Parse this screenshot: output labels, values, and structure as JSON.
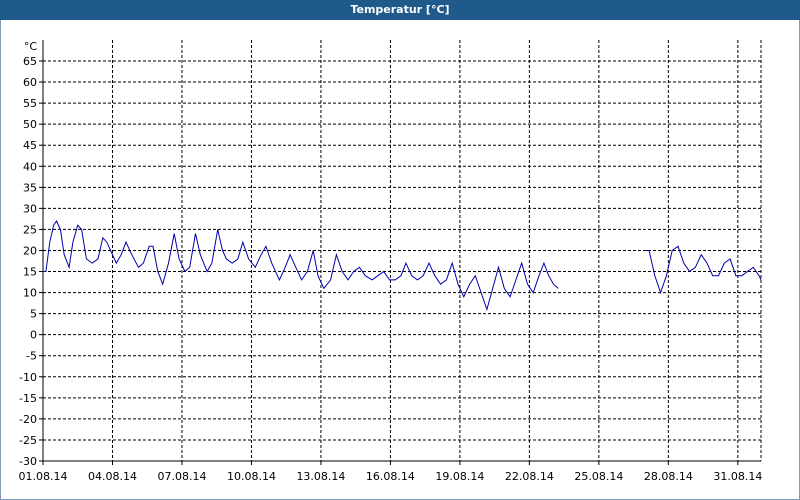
{
  "window": {
    "title": "Temperatur [°C]"
  },
  "chart_data": {
    "type": "line",
    "title": "Temperatur [°C]",
    "ylabel": "°C",
    "xlabel": "",
    "ylim": [
      -30,
      70
    ],
    "yticks": [
      65,
      60,
      55,
      50,
      45,
      40,
      35,
      30,
      25,
      20,
      15,
      10,
      5,
      0,
      -5,
      -10,
      -15,
      -20,
      -25,
      -30
    ],
    "xlim": [
      "2014-08-01",
      "2014-09-01"
    ],
    "xticks": [
      "01.08.14",
      "04.08.14",
      "07.08.14",
      "10.08.14",
      "13.08.14",
      "16.08.14",
      "19.08.14",
      "22.08.14",
      "25.08.14",
      "28.08.14",
      "31.08.14"
    ],
    "grid": true,
    "colors": {
      "line": "#0000aa",
      "grid": "#000000",
      "titlebar": "#1f5a8b"
    },
    "series": [
      {
        "segments": [
          [
            [
              "2014-08-01T00:00",
              15
            ],
            [
              "2014-08-01T03:00",
              15
            ],
            [
              "2014-08-01T07:00",
              22
            ],
            [
              "2014-08-01T11:00",
              26
            ],
            [
              "2014-08-01T14:00",
              27
            ],
            [
              "2014-08-01T18:00",
              25
            ],
            [
              "2014-08-01T22:00",
              19
            ],
            [
              "2014-08-02T03:00",
              16
            ],
            [
              "2014-08-02T07:00",
              22
            ],
            [
              "2014-08-02T12:00",
              26
            ],
            [
              "2014-08-02T16:00",
              25
            ],
            [
              "2014-08-02T21:00",
              18
            ],
            [
              "2014-08-03T03:00",
              17
            ],
            [
              "2014-08-03T09:00",
              18
            ],
            [
              "2014-08-03T14:00",
              23
            ],
            [
              "2014-08-03T18:00",
              22
            ],
            [
              "2014-08-03T22:00",
              20
            ],
            [
              "2014-08-04T04:00",
              17
            ],
            [
              "2014-08-04T09:00",
              19
            ],
            [
              "2014-08-04T14:00",
              22
            ],
            [
              "2014-08-04T20:00",
              19
            ],
            [
              "2014-08-05T03:00",
              16
            ],
            [
              "2014-08-05T08:00",
              17
            ],
            [
              "2014-08-05T14:00",
              21
            ],
            [
              "2014-08-05T18:00",
              21
            ],
            [
              "2014-08-05T23:00",
              15
            ],
            [
              "2014-08-06T04:00",
              12
            ],
            [
              "2014-08-06T10:00",
              17
            ],
            [
              "2014-08-06T16:00",
              24
            ],
            [
              "2014-08-06T21:00",
              18
            ],
            [
              "2014-08-07T03:00",
              15
            ],
            [
              "2014-08-07T08:00",
              16
            ],
            [
              "2014-08-07T14:00",
              24
            ],
            [
              "2014-08-07T19:00",
              19
            ],
            [
              "2014-08-08T02:00",
              15
            ],
            [
              "2014-08-08T07:00",
              17
            ],
            [
              "2014-08-08T13:00",
              25
            ],
            [
              "2014-08-08T18:00",
              20
            ],
            [
              "2014-08-08T22:00",
              18
            ],
            [
              "2014-08-09T04:00",
              17
            ],
            [
              "2014-08-09T10:00",
              18
            ],
            [
              "2014-08-09T15:00",
              22
            ],
            [
              "2014-08-09T21:00",
              18
            ],
            [
              "2014-08-10T04:00",
              16
            ],
            [
              "2014-08-10T10:00",
              19
            ],
            [
              "2014-08-10T15:00",
              21
            ],
            [
              "2014-08-10T21:00",
              17
            ],
            [
              "2014-08-11T05:00",
              13
            ],
            [
              "2014-08-11T11:00",
              16
            ],
            [
              "2014-08-11T16:00",
              19
            ],
            [
              "2014-08-11T22:00",
              16
            ],
            [
              "2014-08-12T04:00",
              13
            ],
            [
              "2014-08-12T10:00",
              15
            ],
            [
              "2014-08-12T16:00",
              20
            ],
            [
              "2014-08-12T21:00",
              14
            ],
            [
              "2014-08-13T03:00",
              11
            ],
            [
              "2014-08-13T10:00",
              13
            ],
            [
              "2014-08-13T16:00",
              19
            ],
            [
              "2014-08-13T22:00",
              15
            ],
            [
              "2014-08-14T04:00",
              13
            ],
            [
              "2014-08-14T10:00",
              15
            ],
            [
              "2014-08-14T16:00",
              16
            ],
            [
              "2014-08-14T22:00",
              14
            ],
            [
              "2014-08-15T05:00",
              13
            ],
            [
              "2014-08-15T11:00",
              14
            ],
            [
              "2014-08-15T17:00",
              15
            ],
            [
              "2014-08-15T23:00",
              13
            ],
            [
              "2014-08-16T05:00",
              13
            ],
            [
              "2014-08-16T11:00",
              14
            ],
            [
              "2014-08-16T16:00",
              17
            ],
            [
              "2014-08-16T22:00",
              14
            ],
            [
              "2014-08-17T04:00",
              13
            ],
            [
              "2014-08-17T10:00",
              14
            ],
            [
              "2014-08-17T16:00",
              17
            ],
            [
              "2014-08-17T22:00",
              14
            ],
            [
              "2014-08-18T04:00",
              12
            ],
            [
              "2014-08-18T10:00",
              13
            ],
            [
              "2014-08-18T16:00",
              17
            ],
            [
              "2014-08-18T22:00",
              12
            ],
            [
              "2014-08-19T04:00",
              9
            ],
            [
              "2014-08-19T10:00",
              12
            ],
            [
              "2014-08-19T16:00",
              14
            ],
            [
              "2014-08-19T22:00",
              10
            ],
            [
              "2014-08-20T04:00",
              6
            ],
            [
              "2014-08-20T10:00",
              11
            ],
            [
              "2014-08-20T16:00",
              16
            ],
            [
              "2014-08-20T22:00",
              11
            ],
            [
              "2014-08-21T04:00",
              9
            ],
            [
              "2014-08-21T10:00",
              13
            ],
            [
              "2014-08-21T16:00",
              17
            ],
            [
              "2014-08-21T22:00",
              12
            ],
            [
              "2014-08-22T04:00",
              10
            ],
            [
              "2014-08-22T10:00",
              14
            ],
            [
              "2014-08-22T15:00",
              17
            ],
            [
              "2014-08-22T20:00",
              14
            ],
            [
              "2014-08-23T01:00",
              12
            ],
            [
              "2014-08-23T06:00",
              11
            ]
          ],
          [
            [
              "2014-08-27T00:00",
              20
            ],
            [
              "2014-08-27T04:00",
              20
            ],
            [
              "2014-08-27T10:00",
              14
            ],
            [
              "2014-08-27T16:00",
              10
            ],
            [
              "2014-08-27T22:00",
              14
            ],
            [
              "2014-08-28T04:00",
              20
            ],
            [
              "2014-08-28T10:00",
              21
            ],
            [
              "2014-08-28T16:00",
              17
            ],
            [
              "2014-08-28T22:00",
              15
            ],
            [
              "2014-08-29T04:00",
              16
            ],
            [
              "2014-08-29T10:00",
              19
            ],
            [
              "2014-08-29T16:00",
              17
            ],
            [
              "2014-08-29T22:00",
              14
            ],
            [
              "2014-08-30T04:00",
              14
            ],
            [
              "2014-08-30T10:00",
              17
            ],
            [
              "2014-08-30T16:00",
              18
            ],
            [
              "2014-08-30T22:00",
              14
            ],
            [
              "2014-08-31T04:00",
              14
            ],
            [
              "2014-08-31T10:00",
              15
            ],
            [
              "2014-08-31T16:00",
              16
            ],
            [
              "2014-08-31T22:00",
              14
            ],
            [
              "2014-09-01T00:00",
              13
            ]
          ]
        ]
      }
    ]
  }
}
